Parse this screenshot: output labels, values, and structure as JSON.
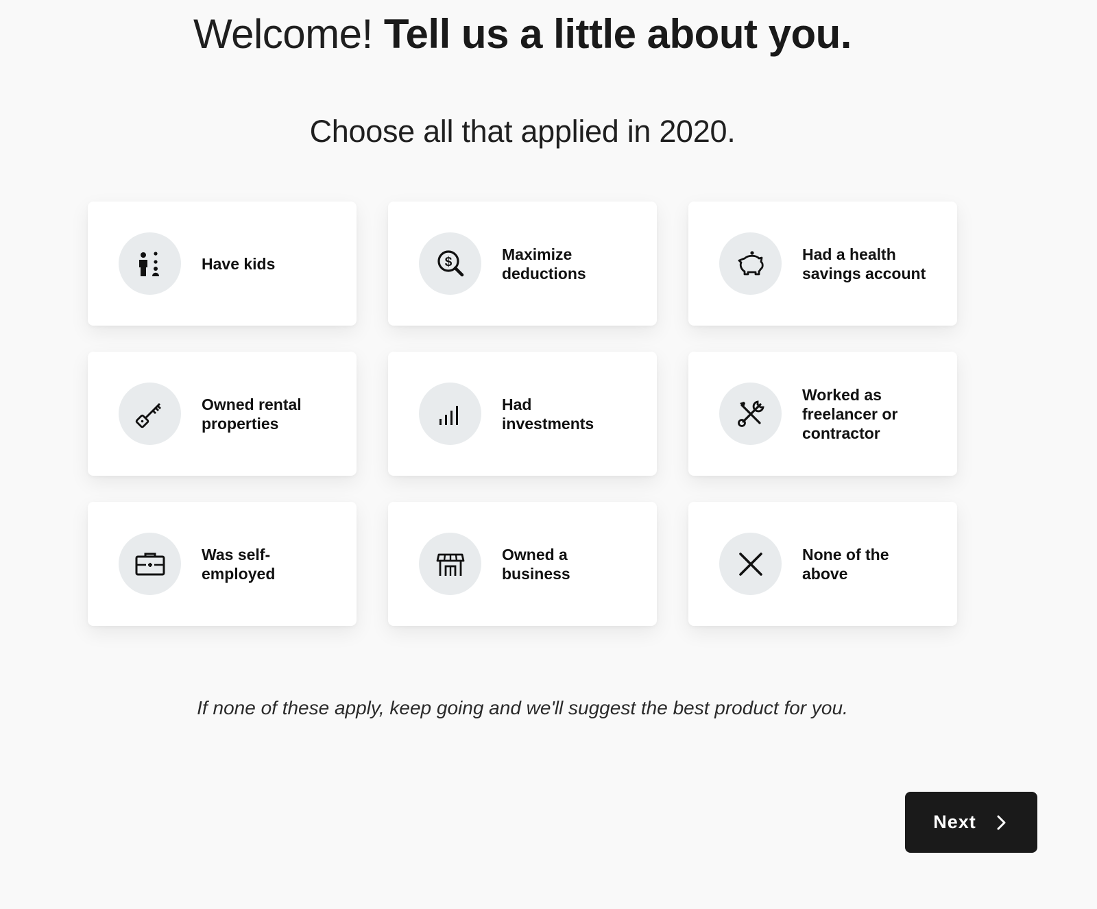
{
  "header": {
    "welcome": "Welcome!",
    "tagline": "Tell us a little about you."
  },
  "subheading": "Choose all that applied in 2020.",
  "options": [
    {
      "label_lines": [
        "Have kids"
      ],
      "icon": "family-icon"
    },
    {
      "label_lines": [
        "Maximize",
        "deductions"
      ],
      "icon": "magnifier-dollar-icon"
    },
    {
      "label_lines": [
        "Had a health",
        "savings account"
      ],
      "icon": "piggy-bank-icon"
    },
    {
      "label_lines": [
        "Owned rental",
        "properties"
      ],
      "icon": "key-icon"
    },
    {
      "label_lines": [
        "Had",
        "investments"
      ],
      "icon": "bar-chart-icon"
    },
    {
      "label_lines": [
        "Worked as",
        "freelancer or",
        "contractor"
      ],
      "icon": "tools-icon"
    },
    {
      "label_lines": [
        "Was self-",
        "employed"
      ],
      "icon": "briefcase-icon"
    },
    {
      "label_lines": [
        "Owned a",
        "business"
      ],
      "icon": "storefront-icon"
    },
    {
      "label_lines": [
        "None of the",
        "above"
      ],
      "icon": "close-icon"
    }
  ],
  "footnote": "If none of these apply, keep going and we'll suggest the best product for you.",
  "next_button": {
    "label": "Next",
    "icon": "chevron-right-icon"
  },
  "colors": {
    "background": "#f9f9f9",
    "card": "#ffffff",
    "icon_circle": "#e8ebed",
    "button": "#1a1a1a",
    "text": "#1a1a1a"
  }
}
